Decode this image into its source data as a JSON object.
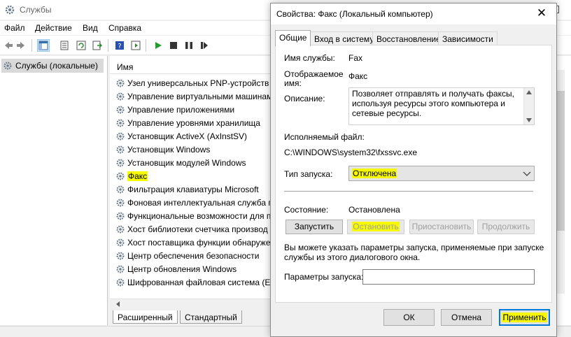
{
  "main_window": {
    "title": "Службы",
    "menu": [
      "Файл",
      "Действие",
      "Вид",
      "Справка"
    ],
    "left_tree_item": "Службы (локальные)",
    "column_name": "Имя",
    "services": [
      "Узел универсальных PNP-устройств",
      "Управление виртуальными машинами",
      "Управление приложениями",
      "Управление уровнями хранилища",
      "Установщик ActiveX (AxInstSV)",
      "Установщик Windows",
      "Установщик модулей Windows",
      "Факс",
      "Фильтрация клавиатуры Microsoft",
      "Фоновая интеллектуальная служба п",
      "Функциональные возможности для п",
      "Хост библиотеки счетчика производ",
      "Хост поставщика функции обнаруже",
      "Центр обеспечения безопасности",
      "Центр обновления Windows",
      "Шифрованная файловая система (EF"
    ],
    "bottom_tabs": [
      "Расширенный",
      "Стандартный"
    ]
  },
  "dialog": {
    "title": "Свойства: Факс (Локальный компьютер)",
    "close_glyph": "✕",
    "tabs": [
      "Общие",
      "Вход в систему",
      "Восстановление",
      "Зависимости"
    ],
    "service_name_label": "Имя службы:",
    "service_name_value": "Fax",
    "display_name_label_1": "Отображаемое",
    "display_name_label_2": "имя:",
    "display_name_value": "Факс",
    "description_label": "Описание:",
    "description_value": "Позволяет отправлять и получать факсы, используя ресурсы этого компьютера и сетевые ресурсы.",
    "exe_label": "Исполняемый файл:",
    "exe_value": "C:\\WINDOWS\\system32\\fxssvc.exe",
    "startup_type_label": "Тип запуска:",
    "startup_type_value": "Отключена",
    "state_label": "Состояние:",
    "state_value": "Остановлена",
    "buttons": {
      "start": "Запустить",
      "stop": "Остановить",
      "pause": "Приостановить",
      "resume": "Продолжить"
    },
    "hint_line_1": "Вы можете указать параметры запуска, применяемые при запуске",
    "hint_line_2": "службы из этого диалогового окна.",
    "params_label": "Параметры запуска:",
    "params_value": "",
    "ok": "ОК",
    "cancel": "Отмена",
    "apply": "Применить"
  },
  "colors": {
    "highlight": "#f6f900",
    "accent": "#0078d7"
  }
}
